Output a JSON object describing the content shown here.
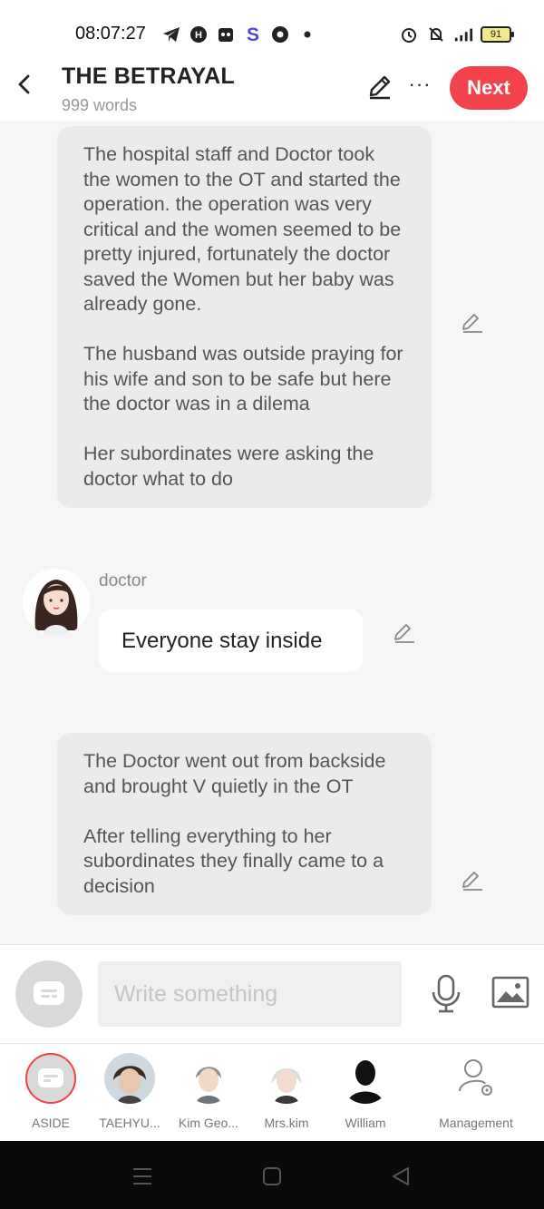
{
  "status_bar": {
    "time": "08:07:27",
    "battery": "91",
    "left_icons": [
      "telegram-icon",
      "app-icon",
      "game-icon",
      "s-app-icon",
      "chrome-icon",
      "dot-icon"
    ],
    "right_icons": [
      "alarm-icon",
      "mute-bell-icon",
      "signal-icon",
      "battery-icon"
    ]
  },
  "header": {
    "title": "THE BETRAYAL",
    "word_count": "999 words",
    "more_label": "···",
    "next_label": "Next"
  },
  "messages": [
    {
      "type": "aside",
      "paragraphs": [
        "The hospital staff and Doctor took the women to the OT and started the operation. the operation was very critical and the women seemed to be pretty injured, fortunately the doctor saved the Women but her baby was already gone.",
        "The husband was outside praying for his wife and son to be safe but here the doctor was in a dilema",
        "Her subordinates were asking the doctor what to do"
      ]
    },
    {
      "type": "character",
      "name": "doctor",
      "text": "Everyone stay inside"
    },
    {
      "type": "aside",
      "paragraphs": [
        "The Doctor went out from backside and brought V quietly in the OT",
        "After telling everything to her subordinates they finally came to a decision"
      ]
    }
  ],
  "composer": {
    "placeholder": "Write something"
  },
  "characters": [
    {
      "label": "ASIDE"
    },
    {
      "label": "TAEHYU..."
    },
    {
      "label": "Kim Geo..."
    },
    {
      "label": "Mrs.kim"
    },
    {
      "label": "William"
    },
    {
      "label": "Management"
    }
  ],
  "colors": {
    "accent": "#f2424c",
    "aside_bubble": "#ebebeb",
    "background": "#f6f6f6"
  }
}
